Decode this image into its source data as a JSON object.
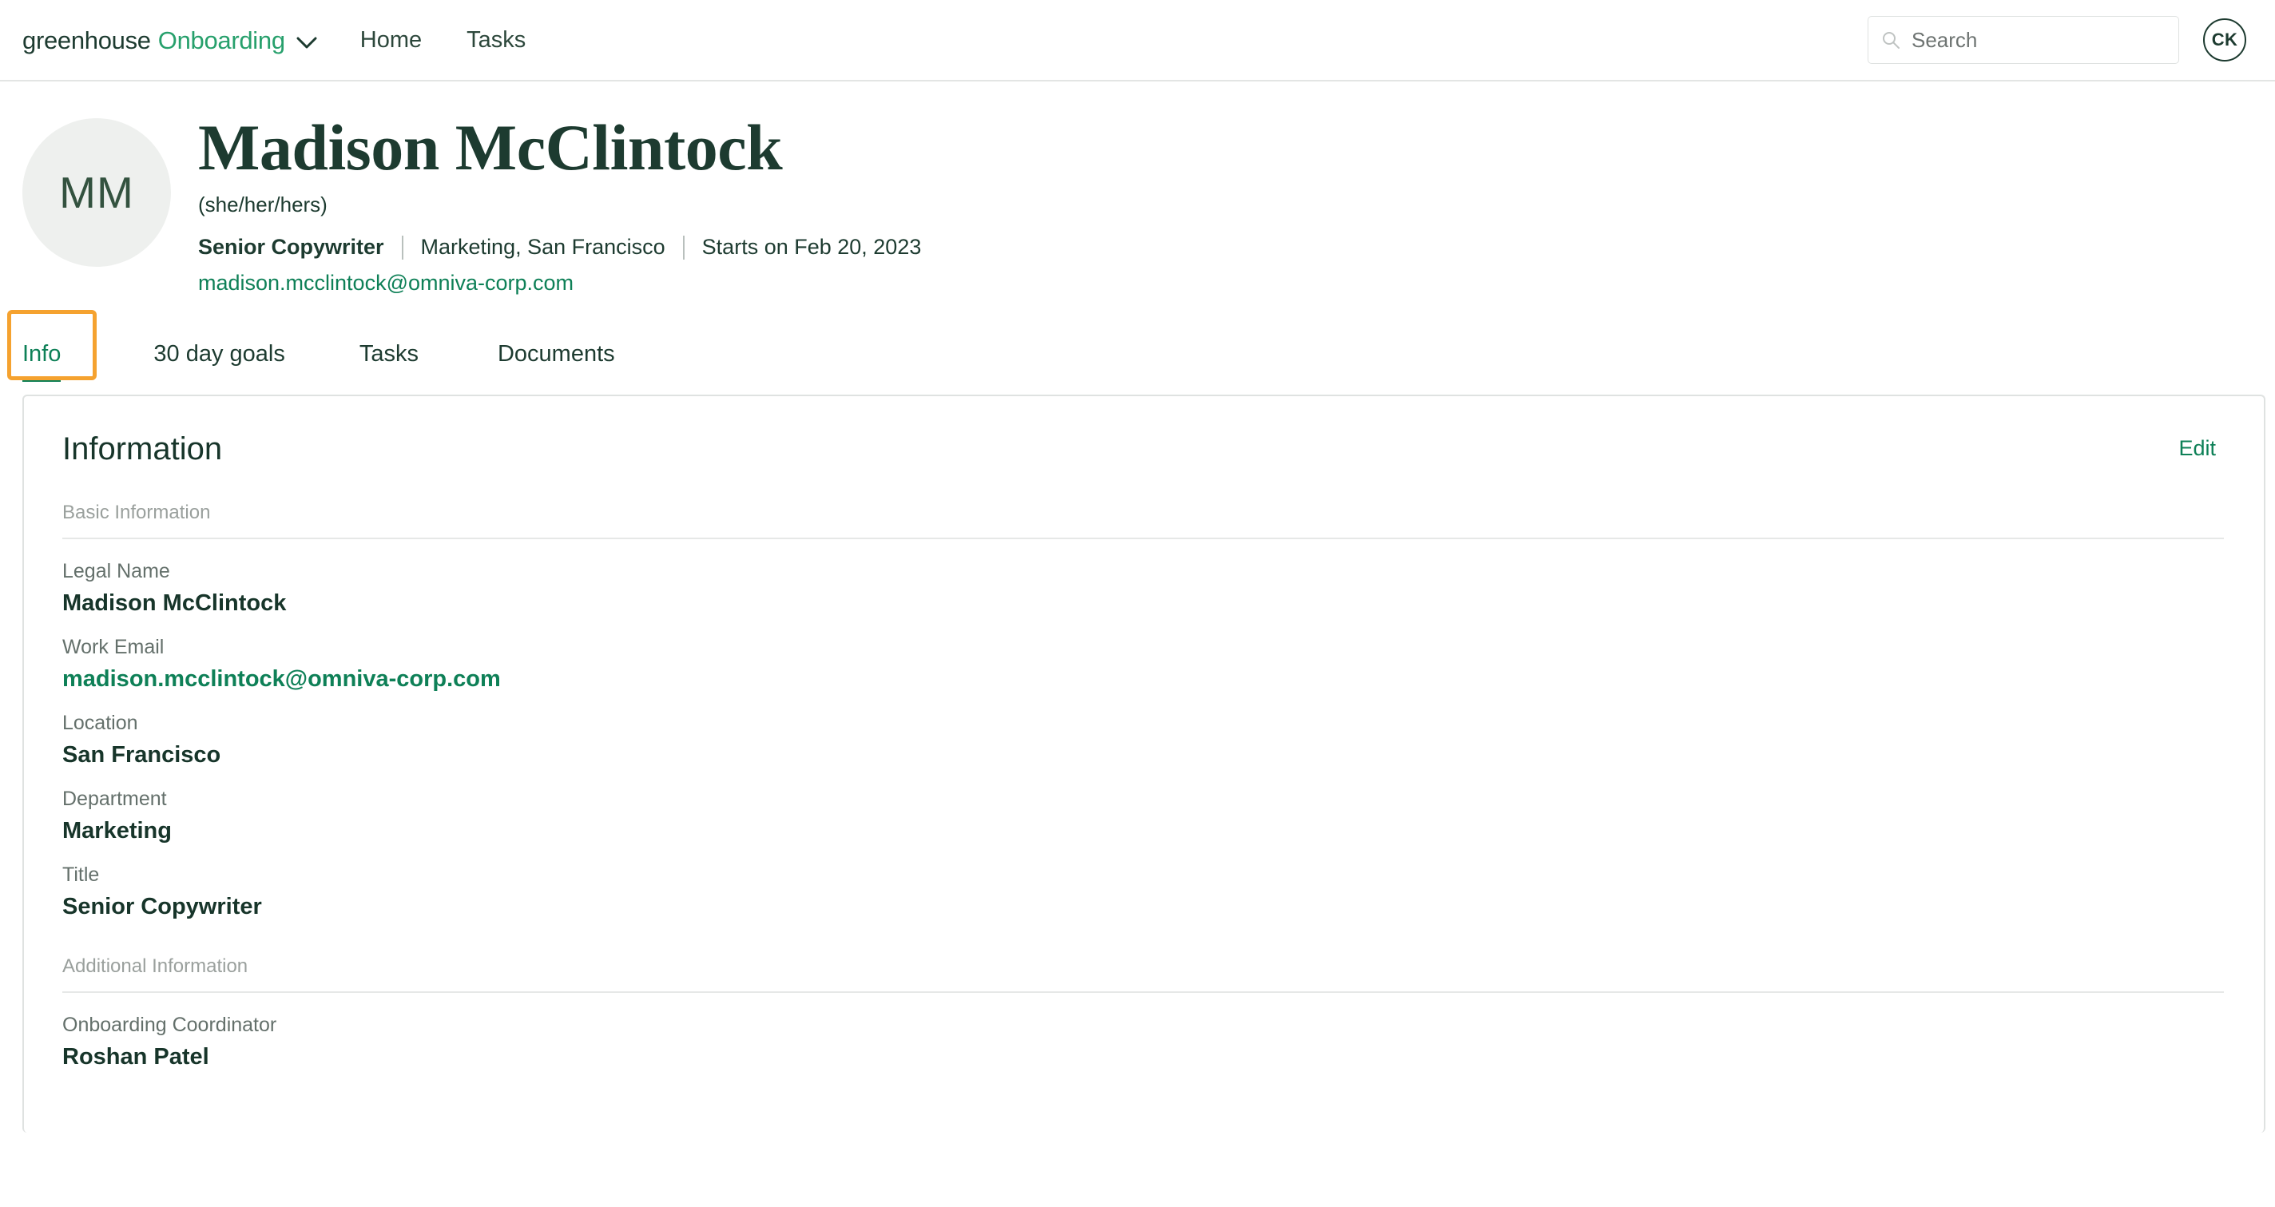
{
  "header": {
    "brand_primary": "greenhouse",
    "brand_secondary": "Onboarding",
    "brand_chevron_icon": "chevron-down-icon",
    "nav": [
      {
        "label": "Home"
      },
      {
        "label": "Tasks"
      }
    ],
    "search": {
      "icon": "search-icon",
      "placeholder": "Search",
      "value": ""
    },
    "account_avatar_initials": "CK"
  },
  "profile": {
    "avatar_initials": "MM",
    "name": "Madison McClintock",
    "pronouns": "(she/her/hers)",
    "title": "Senior Copywriter",
    "department_location": "Marketing, San Francisco",
    "start_date": "Starts on Feb 20, 2023",
    "email": "madison.mcclintock@omniva-corp.com"
  },
  "tabs": [
    {
      "label": "Info",
      "active": true
    },
    {
      "label": "30 day goals",
      "active": false
    },
    {
      "label": "Tasks",
      "active": false
    },
    {
      "label": "Documents",
      "active": false
    }
  ],
  "card": {
    "title": "Information",
    "edit_label": "Edit",
    "sections": [
      {
        "label": "Basic Information",
        "fields": [
          {
            "label": "Legal Name",
            "value": "Madison McClintock",
            "is_link": false
          },
          {
            "label": "Work Email",
            "value": "madison.mcclintock@omniva-corp.com",
            "is_link": true
          },
          {
            "label": "Location",
            "value": "San Francisco",
            "is_link": false
          },
          {
            "label": "Department",
            "value": "Marketing",
            "is_link": false
          },
          {
            "label": "Title",
            "value": "Senior Copywriter",
            "is_link": false
          }
        ]
      },
      {
        "label": "Additional Information",
        "fields": [
          {
            "label": "Onboarding Coordinator",
            "value": "Roshan Patel",
            "is_link": false
          }
        ]
      }
    ]
  },
  "colors": {
    "brand_green": "#27a06c",
    "link_green": "#0e8057",
    "dark_green": "#1d3b30",
    "focus_orange": "#f5a22f",
    "avatar_bg": "#eef0ee",
    "border": "#dfe2e1"
  }
}
